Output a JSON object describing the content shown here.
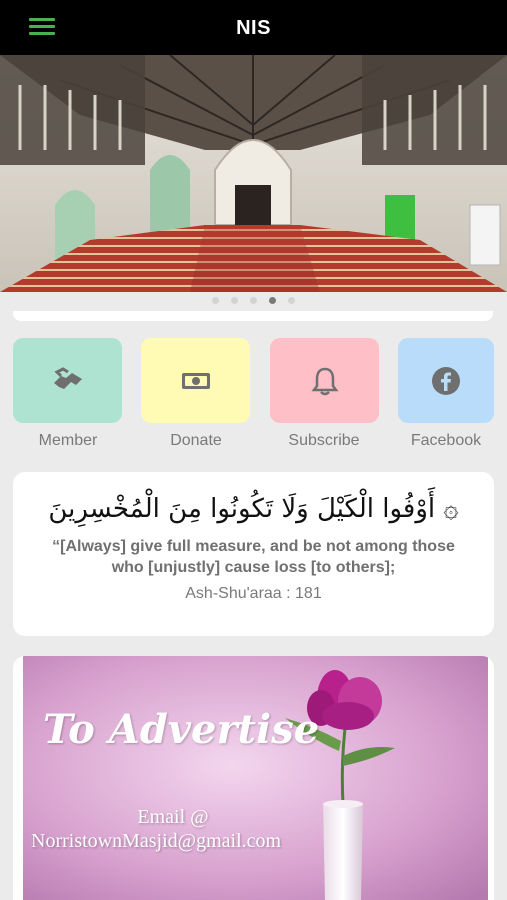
{
  "header": {
    "title": "NIS",
    "menu_icon": "hamburger-menu-icon",
    "accent_color": "#4caf50"
  },
  "carousel": {
    "slides": 5,
    "active_index": 3
  },
  "actions": [
    {
      "label": "Member",
      "icon": "handshake-icon",
      "color": "#aee3d2"
    },
    {
      "label": "Donate",
      "icon": "banknote-icon",
      "color": "#fffbb5"
    },
    {
      "label": "Subscribe",
      "icon": "bell-icon",
      "color": "#ffbfc7"
    },
    {
      "label": "Facebook",
      "icon": "facebook-icon",
      "color": "#b9dcfb"
    }
  ],
  "verse": {
    "arabic": "۞ أَوْفُوا الْكَيْلَ وَلَا تَكُونُوا مِنَ الْمُخْسِرِينَ",
    "translation": "“[Always] give full measure, and be not among those who [unjustly] cause loss [to others];",
    "reference": "Ash-Shu'araa : 181"
  },
  "advert": {
    "title": "To Advertise",
    "email_label": "Email @",
    "email": "NorristownMasjid@gmail.com"
  }
}
